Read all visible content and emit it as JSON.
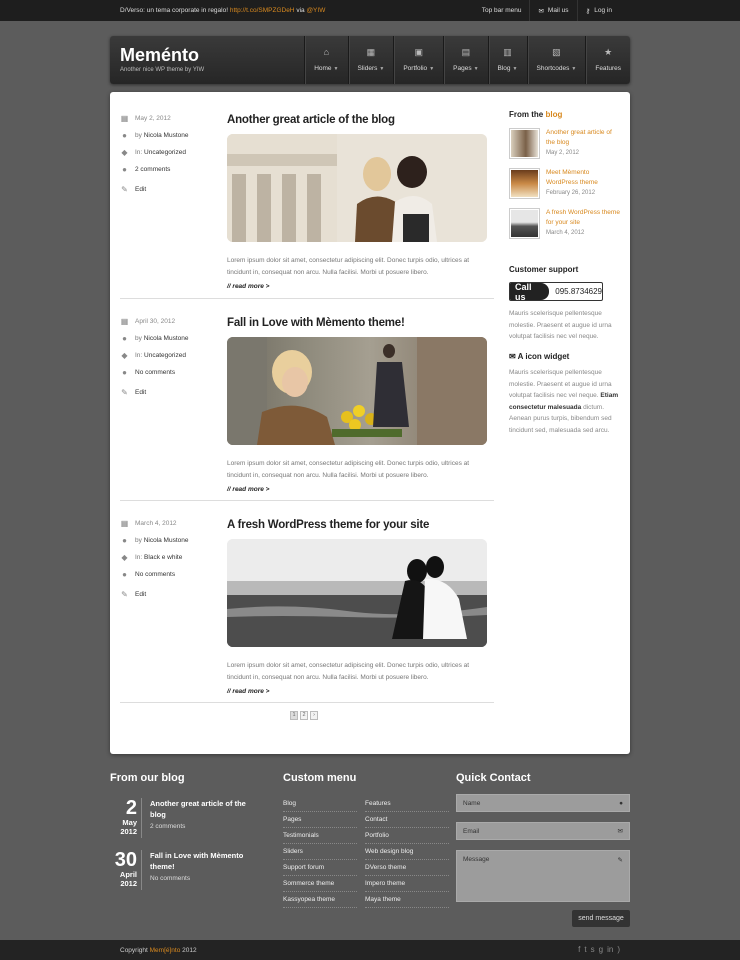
{
  "topbar": {
    "message_prefix": "D/Verso: un tema corporate in regalo!",
    "message_link": "http://t.co/SMPZGDeH",
    "message_via": "via",
    "message_handle": "@YIW",
    "links": [
      {
        "label": "Top bar menu",
        "icon": "none"
      },
      {
        "label": "Mail us",
        "icon": "mail-icon"
      },
      {
        "label": "Log in",
        "icon": "key-icon"
      }
    ]
  },
  "header": {
    "logo": "Meménto",
    "tagline": "Another nice WP theme by YIW",
    "nav": [
      {
        "label": "Home",
        "icon": "home-icon",
        "glyph": "⌂",
        "dropdown": true
      },
      {
        "label": "Sliders",
        "icon": "film-icon",
        "glyph": "▦",
        "dropdown": true
      },
      {
        "label": "Portfolio",
        "icon": "image-icon",
        "glyph": "▣",
        "dropdown": true
      },
      {
        "label": "Pages",
        "icon": "page-icon",
        "glyph": "▤",
        "dropdown": true
      },
      {
        "label": "Blog",
        "icon": "calendar-icon",
        "glyph": "▥",
        "dropdown": true
      },
      {
        "label": "Shortcodes",
        "icon": "code-icon",
        "glyph": "▧",
        "dropdown": true
      },
      {
        "label": "Features",
        "icon": "star-icon",
        "glyph": "★",
        "dropdown": false
      }
    ]
  },
  "posts": [
    {
      "date": "May 2, 2012",
      "author_prefix": "by",
      "author": "Nicola Mustone",
      "category_prefix": "In:",
      "category": "Uncategorized",
      "comments": "2 comments",
      "edit": "Edit",
      "title": "Another great article of the blog",
      "excerpt": "Lorem ipsum dolor sit amet, consectetur adipiscing elit. Donec turpis odio, ultrices at tincidunt in, consequat non arcu. Nulla facilisi. Morbi ut posuere libero.",
      "read_more": "// read more >"
    },
    {
      "date": "April 30, 2012",
      "author_prefix": "by",
      "author": "Nicola Mustone",
      "category_prefix": "In:",
      "category": "Uncategorized",
      "comments": "No comments",
      "edit": "Edit",
      "title": "Fall in Love with Mèmento theme!",
      "excerpt": "Lorem ipsum dolor sit amet, consectetur adipiscing elit. Donec turpis odio, ultrices at tincidunt in, consequat non arcu. Nulla facilisi. Morbi ut posuere libero.",
      "read_more": "// read more >"
    },
    {
      "date": "March 4, 2012",
      "author_prefix": "by",
      "author": "Nicola Mustone",
      "category_prefix": "In:",
      "category": "Black e white",
      "comments": "No comments",
      "edit": "Edit",
      "title": "A fresh WordPress theme for your site",
      "excerpt": "Lorem ipsum dolor sit amet, consectetur adipiscing elit. Donec turpis odio, ultrices at tincidunt in, consequat non arcu. Nulla facilisi. Morbi ut posuere libero.",
      "read_more": "// read more >"
    }
  ],
  "pagination": [
    "1",
    "2",
    "›"
  ],
  "sidebar": {
    "from_blog_prefix": "From the",
    "from_blog_accent": "blog",
    "recent": [
      {
        "title": "Another great article of the blog",
        "date": "May 2, 2012"
      },
      {
        "title": "Meet Mèmento WordPress theme",
        "date": "February 26, 2012"
      },
      {
        "title": "A fresh WordPress theme for your site",
        "date": "March 4, 2012"
      }
    ],
    "support_title": "Customer support",
    "call_label": "Call us",
    "call_number": "095.8734629",
    "support_text": "Mauris scelerisque pellentesque molestie. Praesent et augue id urna volutpat facilisis nec vel neque.",
    "icon_widget_title": "A icon widget",
    "icon_widget_text_1": "Mauris scelerisque pellentesque molestie. Praesent et augue id urna volutpat facilisis nec vel neque.",
    "icon_widget_bold": "Etiam consectetur malesuada",
    "icon_widget_text_2": "dictum. Aenean purus turpis, bibendum sed tincidunt sed, malesuada sed arcu."
  },
  "footer": {
    "blog_title": "From our blog",
    "blog_posts": [
      {
        "day": "2",
        "month": "May",
        "year": "2012",
        "title": "Another great article of the blog",
        "comments": "2 comments"
      },
      {
        "day": "30",
        "month": "April",
        "year": "2012",
        "title": "Fall in Love with Mèmento theme!",
        "comments": "No comments"
      }
    ],
    "menu_title": "Custom menu",
    "menu_left": [
      "Blog",
      "Pages",
      "Testimonials",
      "Sliders",
      "Support forum",
      "Sommerce theme",
      "Kassyopea theme"
    ],
    "menu_right": [
      "Features",
      "Contact",
      "Portfolio",
      "Web design blog",
      "DVerso theme",
      "Impero theme",
      "Maya theme"
    ],
    "contact_title": "Quick Contact",
    "name_placeholder": "Name",
    "email_placeholder": "Email",
    "message_placeholder": "Message",
    "send_label": "send message"
  },
  "bottom": {
    "copyright_prefix": "Copyright",
    "brand": "Mem[é]nto",
    "year": "2012"
  },
  "colors": {
    "accent": "#d8891f",
    "topbar": "#1e1e1e",
    "background": "#5c5c5c"
  }
}
